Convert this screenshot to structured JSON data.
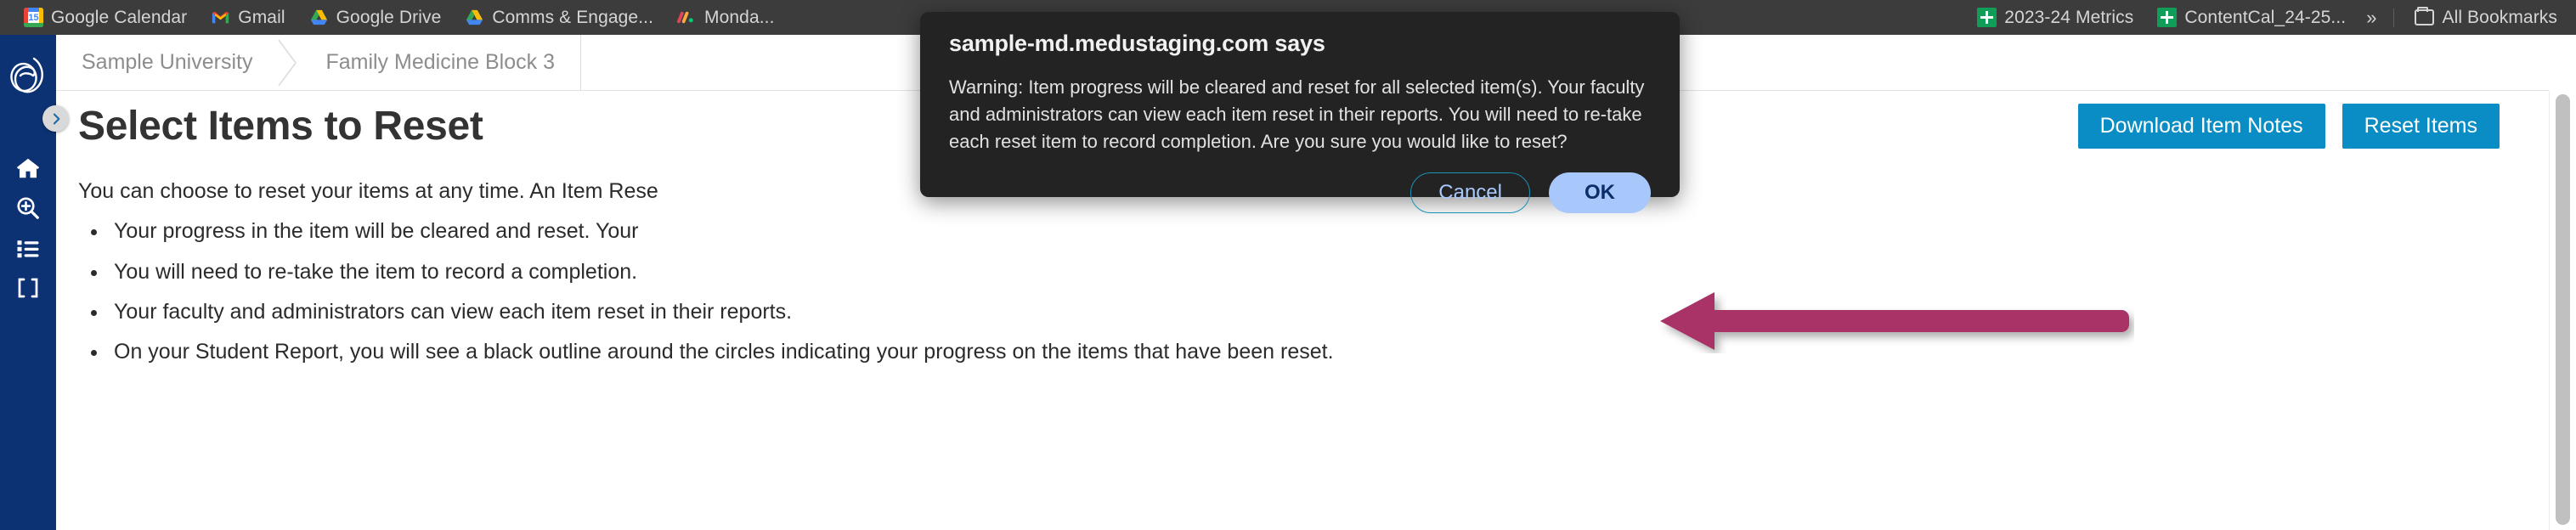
{
  "browser": {
    "bookmarks": [
      {
        "label": "Google Calendar",
        "icon": "google-calendar-icon",
        "day": "15"
      },
      {
        "label": "Gmail",
        "icon": "gmail-icon"
      },
      {
        "label": "Google Drive",
        "icon": "google-drive-icon"
      },
      {
        "label": "Comms & Engage...",
        "icon": "google-drive-icon"
      },
      {
        "label": "Monda...",
        "icon": "monday-icon"
      },
      {
        "label": "2023-24 Metrics",
        "icon": "google-sheets-icon"
      },
      {
        "label": "ContentCal_24-25...",
        "icon": "google-sheets-icon"
      }
    ],
    "overflow_label": "»",
    "all_bookmarks_label": "All Bookmarks"
  },
  "sidebar": {
    "logo_name": "app-logo",
    "expand_label": "›",
    "items": [
      {
        "name": "home",
        "icon": "home-icon"
      },
      {
        "name": "search",
        "icon": "search-plus-icon"
      },
      {
        "name": "list",
        "icon": "list-icon"
      },
      {
        "name": "brackets",
        "icon": "brackets-icon"
      }
    ]
  },
  "breadcrumb": {
    "items": [
      {
        "label": "Sample University"
      },
      {
        "label": "Family Medicine Block 3"
      }
    ]
  },
  "main": {
    "title": "Select Items to Reset",
    "actions": [
      {
        "label": "Download Item Notes"
      },
      {
        "label": "Reset Items"
      }
    ],
    "intro": "You can choose to reset your items at any time. An Item Rese",
    "bullets": [
      "Your progress in the item will be cleared and reset. Your",
      "You will need to re-take the item to record a completion.",
      "Your faculty and administrators can view each item reset in their reports.",
      "On your Student Report, you will see a black outline around the circles indicating your progress on the items that have been reset."
    ]
  },
  "dialog": {
    "title": "sample-md.medustaging.com says",
    "message": "Warning: Item progress will be cleared and reset for all selected item(s). Your faculty and administrators can view each item reset in their reports. You will need to re-take each reset item to record completion. Are you sure you would like to reset?",
    "cancel_label": "Cancel",
    "ok_label": "OK"
  },
  "annotation": {
    "arrow_name": "pointer-arrow",
    "color": "#a93066"
  },
  "colors": {
    "accent_blue": "#0a8cc4",
    "rail_navy": "#0c3274",
    "dialog_bg": "#232323",
    "ok_button": "#a8c7fa",
    "arrow": "#a93066",
    "bookmarks_bar": "#3c3c3c"
  }
}
